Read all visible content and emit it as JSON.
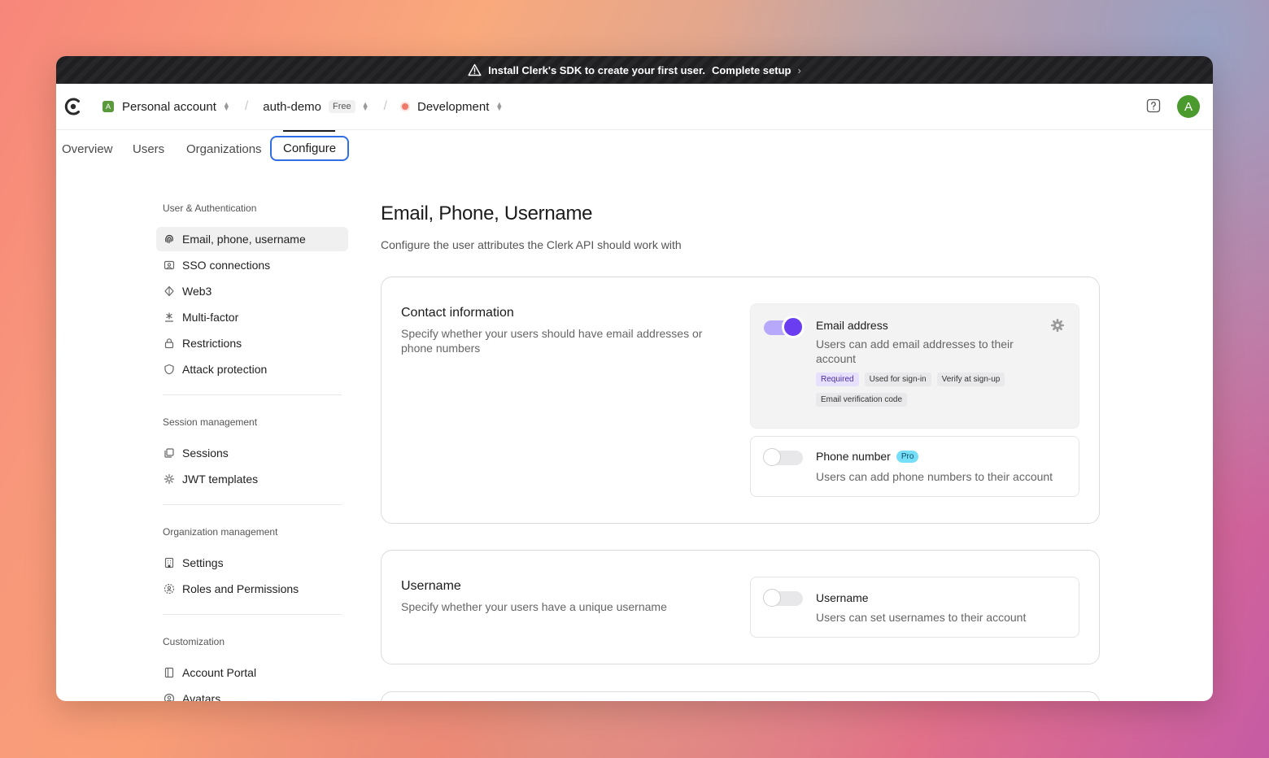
{
  "banner": {
    "message": "Install Clerk's SDK to create your first user.",
    "link": "Complete setup",
    "chevron": "›"
  },
  "topbar": {
    "account_initial": "A",
    "account_name": "Personal account",
    "app_name": "auth-demo",
    "plan_badge": "Free",
    "environment": "Development",
    "user_initial": "A",
    "colors": {
      "account_badge": "#5a9a3c",
      "env_dot": "#f07a6a",
      "avatar": "#4a9a2e"
    }
  },
  "tabs": [
    {
      "label": "Overview"
    },
    {
      "label": "Users"
    },
    {
      "label": "Organizations"
    },
    {
      "label": "Configure",
      "active": true
    }
  ],
  "sidebar": {
    "sections": [
      {
        "heading": "User & Authentication",
        "items": [
          {
            "label": "Email, phone, username",
            "icon": "fingerprint-icon",
            "active": true
          },
          {
            "label": "SSO connections",
            "icon": "sso-icon"
          },
          {
            "label": "Web3",
            "icon": "web3-icon"
          },
          {
            "label": "Multi-factor",
            "icon": "asterisk-icon"
          },
          {
            "label": "Restrictions",
            "icon": "lock-icon"
          },
          {
            "label": "Attack protection",
            "icon": "shield-icon"
          }
        ]
      },
      {
        "heading": "Session management",
        "items": [
          {
            "label": "Sessions",
            "icon": "sessions-icon"
          },
          {
            "label": "JWT templates",
            "icon": "jwt-icon"
          }
        ]
      },
      {
        "heading": "Organization management",
        "items": [
          {
            "label": "Settings",
            "icon": "building-icon"
          },
          {
            "label": "Roles and Permissions",
            "icon": "roles-icon"
          }
        ]
      },
      {
        "heading": "Customization",
        "items": [
          {
            "label": "Account Portal",
            "icon": "portal-icon"
          },
          {
            "label": "Avatars",
            "icon": "avatar-icon"
          }
        ]
      }
    ]
  },
  "main": {
    "title": "Email, Phone, Username",
    "subtitle": "Configure the user attributes the Clerk API should work with",
    "contact": {
      "title": "Contact information",
      "description": "Specify whether your users should have email addresses or phone numbers",
      "email": {
        "title": "Email address",
        "description": "Users can add email addresses to their account",
        "enabled": true,
        "tags": [
          "Required",
          "Used for sign-in",
          "Verify at sign-up",
          "Email verification code"
        ]
      },
      "phone": {
        "title": "Phone number",
        "badge": "Pro",
        "description": "Users can add phone numbers to their account",
        "enabled": false
      }
    },
    "username": {
      "title": "Username",
      "description": "Specify whether your users have a unique username",
      "option": {
        "title": "Username",
        "description": "Users can set usernames to their account",
        "enabled": false
      }
    },
    "colors": {
      "toggle_on": "#6a3df0",
      "tab_focus": "#2f6ee6",
      "pro_badge": "#76dff7"
    }
  }
}
